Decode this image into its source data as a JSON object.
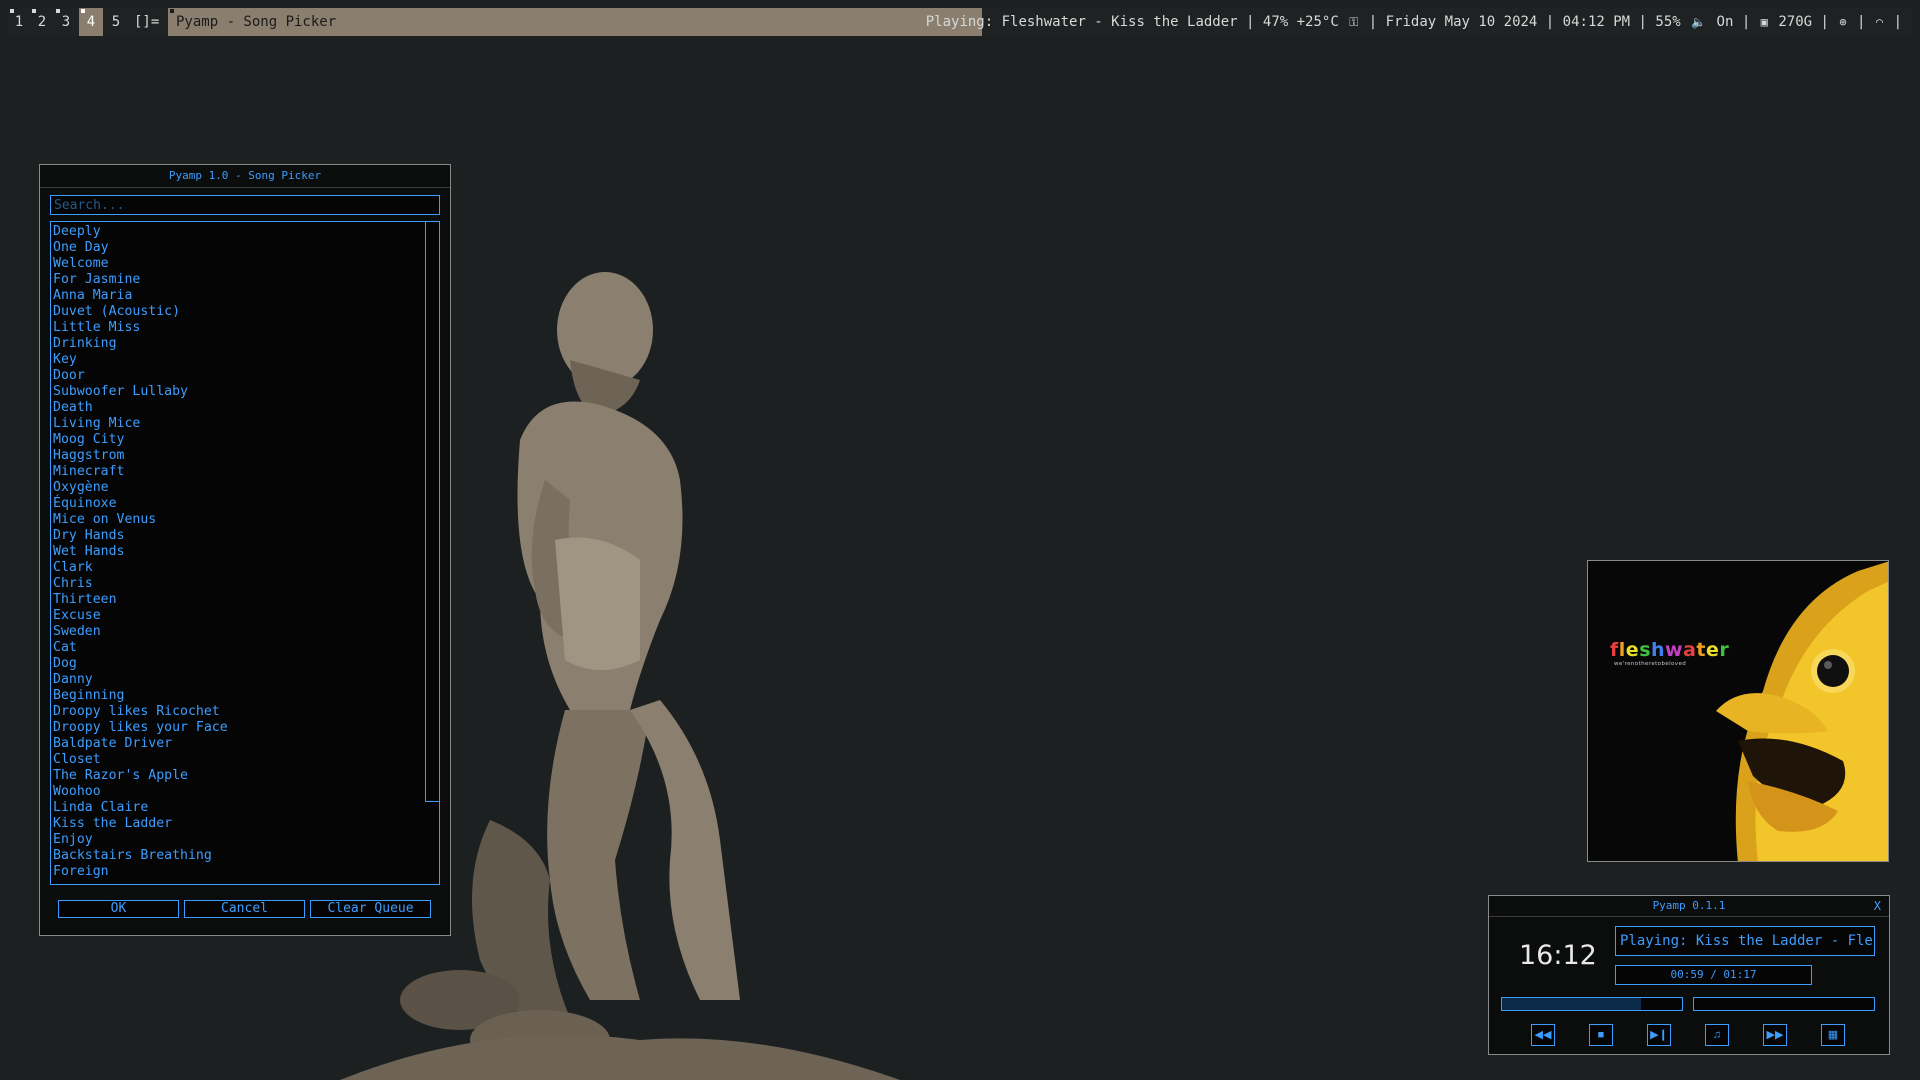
{
  "bar": {
    "workspaces": [
      "1",
      "2",
      "3",
      "4",
      "5"
    ],
    "active_workspace": "4",
    "layout": "[]=",
    "window_title": "Pyamp - Song Picker",
    "status": {
      "playing": "Playing: Fleshwater - Kiss the Ladder",
      "cpu_temp": "47% +25°C",
      "date": "Friday May 10 2024",
      "time": "04:12 PM",
      "volume": "55%",
      "volume_state": "On",
      "disk": "270G",
      "icons": [
        "lock-icon",
        "speaker-icon",
        "disk-icon",
        "globe-icon",
        "wifi-icon"
      ]
    }
  },
  "picker": {
    "title": "Pyamp 1.0 - Song Picker",
    "search_placeholder": "Search...",
    "songs": [
      "Deeply",
      "One Day",
      "Welcome",
      "For Jasmine",
      "Anna Maria",
      "Duvet (Acoustic)",
      "Little Miss",
      "Drinking",
      "Key",
      "Door",
      "Subwoofer Lullaby",
      "Death",
      "Living Mice",
      "Moog City",
      "Haggstrom",
      "Minecraft",
      "Oxygène",
      "Équinoxe",
      "Mice on Venus",
      "Dry Hands",
      "Wet Hands",
      "Clark",
      "Chris",
      "Thirteen",
      "Excuse",
      "Sweden",
      "Cat",
      "Dog",
      "Danny",
      "Beginning",
      "Droopy likes Ricochet",
      "Droopy likes your Face",
      "Baldpate Driver",
      "Closet",
      "The Razor's Apple",
      "Woohoo",
      "Linda Claire",
      "Kiss the Ladder",
      "Enjoy",
      "Backstairs Breathing",
      "Foreign"
    ],
    "buttons": {
      "ok": "OK",
      "cancel": "Cancel",
      "clear": "Clear Queue"
    }
  },
  "album": {
    "artist_logo": "fleshwater",
    "subtitle": "we'renotheretobeloved",
    "logo_colors": [
      "#e84040",
      "#f0a020",
      "#e8e020",
      "#40c040",
      "#4080f0",
      "#c040c0"
    ]
  },
  "player": {
    "title": "Pyamp 0.1.1",
    "close": "X",
    "clock": "16:12",
    "now_playing": "Playing: Kiss the Ladder - Fleshwater",
    "time_readout": "00:59 / 01:17",
    "progress": 0.77,
    "volume": 0.0,
    "controls": {
      "prev": "◀◀",
      "stop": "■",
      "play_pause": "▶❙",
      "queue": "♫",
      "next": "▶▶",
      "menu": "▦"
    }
  },
  "colors": {
    "accent": "#3c9dff",
    "bar_highlight": "#8a7e6e",
    "background": "#1c2021"
  }
}
